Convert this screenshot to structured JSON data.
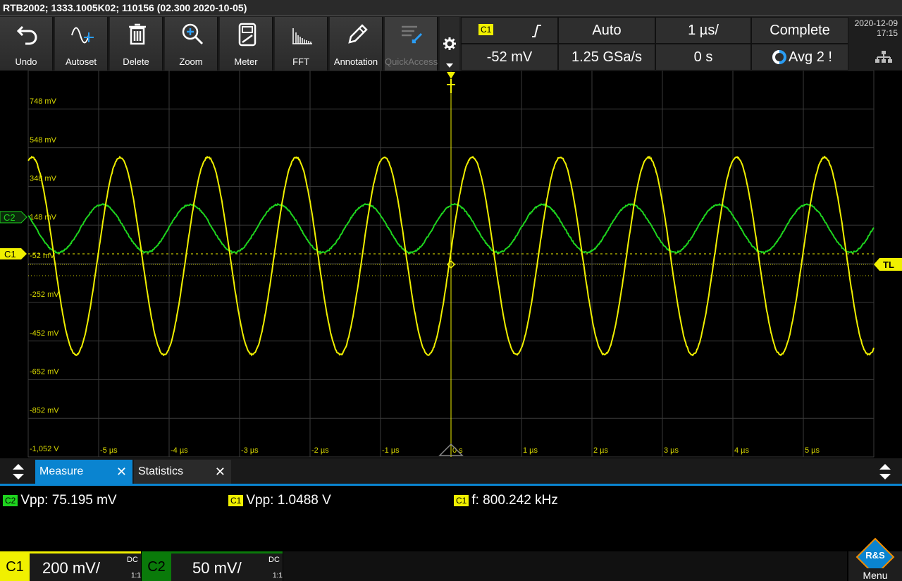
{
  "title": "RTB2002; 1333.1005K02; 110156 (02.300 2020-10-05)",
  "toolbar": {
    "undo": "Undo",
    "autoset": "Autoset",
    "delete": "Delete",
    "zoom": "Zoom",
    "meter": "Meter",
    "fft": "FFT",
    "annotation": "Annotation",
    "quickaccess": "QuickAccess"
  },
  "trigger": {
    "source": "C1",
    "edge_symbol": "∕̅",
    "mode": "Auto",
    "timebase": "1 µs/",
    "status": "Complete",
    "level": "-52 mV",
    "sample_rate": "1.25 GSa/s",
    "offset": "0 s",
    "acq": "Avg 2 !"
  },
  "datetime": {
    "date": "2020-12-09",
    "time": "17:15"
  },
  "plot": {
    "y_labels": [
      "748 mV",
      "548 mV",
      "348 mV",
      "148 mV",
      "-52 mV",
      "-252 mV",
      "-452 mV",
      "-652 mV",
      "-852 mV",
      "-1,052 V"
    ],
    "x_labels": [
      "-5 µs",
      "-4 µs",
      "-3 µs",
      "-2 µs",
      "-1 µs",
      "0 s",
      "1 µs",
      "2 µs",
      "3 µs",
      "4 µs",
      "5 µs"
    ],
    "c1_marker": "C1",
    "c2_marker": "C2",
    "tl_marker": "TL",
    "colors": {
      "c1": "#f0f000",
      "c2": "#1ed41e",
      "grid": "#3a3a3a",
      "accent": "#0a84d0"
    }
  },
  "tabs": {
    "measure": "Measure",
    "statistics": "Statistics",
    "close": "✕"
  },
  "measurements": [
    {
      "channel": "C2",
      "text": "Vpp: 75.195 mV"
    },
    {
      "channel": "C1",
      "text": "Vpp: 1.0488 V"
    },
    {
      "channel": "C1",
      "text": "f: 800.242 kHz"
    }
  ],
  "channels": [
    {
      "name": "C1",
      "scale": "200 mV/",
      "coupling": "DC",
      "probe": "1:1"
    },
    {
      "name": "C2",
      "scale": "50 mV/",
      "coupling": "DC",
      "probe": "1:1"
    }
  ],
  "menu": "Menu",
  "logo": "R&S"
}
